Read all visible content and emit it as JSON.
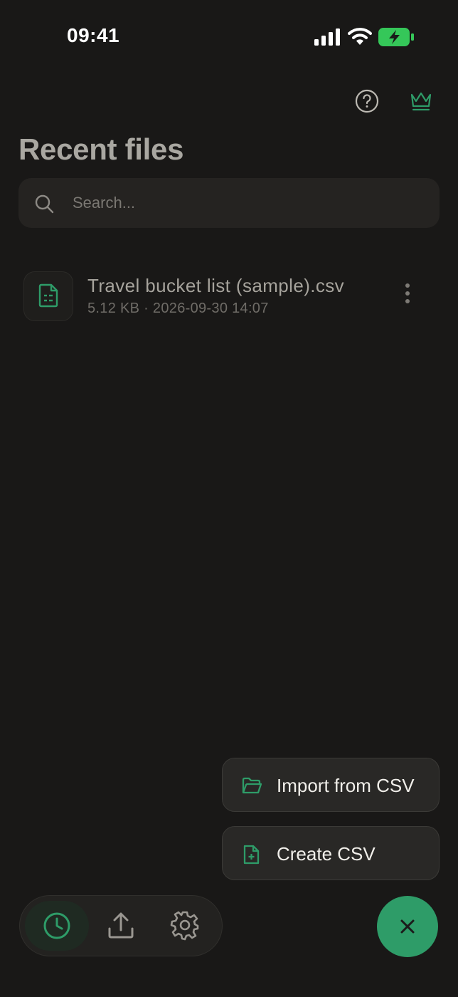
{
  "status_bar": {
    "time": "09:41"
  },
  "header": {
    "title": "Recent files"
  },
  "search": {
    "placeholder": "Search..."
  },
  "files": [
    {
      "name": "Travel bucket list (sample).csv",
      "meta": "5.12 KB · 2026-09-30 14:07"
    }
  ],
  "action_menu": {
    "import_label": "Import from CSV",
    "create_label": "Create CSV"
  },
  "bottom_nav": {
    "items": [
      "clock-icon",
      "upload-icon",
      "gear-icon"
    ],
    "active": "clock-icon"
  },
  "colors": {
    "accent": "#2e9c68",
    "background": "#191817"
  }
}
